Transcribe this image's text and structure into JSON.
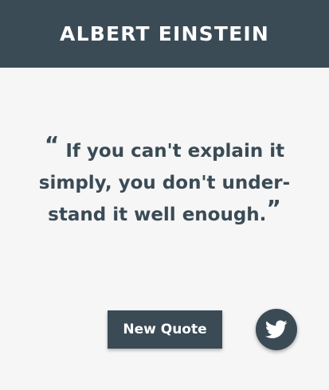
{
  "header": {
    "title": "ALBERT EINSTEIN"
  },
  "quote": {
    "open_mark": "“",
    "line1": "If you can't explain it",
    "line2": "simply, you don't under-",
    "line3": "stand it well enough.",
    "close_mark": "”"
  },
  "actions": {
    "new_quote_label": "New Quote",
    "tweet_icon": "twitter-bird-icon"
  },
  "colors": {
    "primary": "#3a4b56",
    "background": "#f6f6f6",
    "text_light": "#ffffff"
  }
}
